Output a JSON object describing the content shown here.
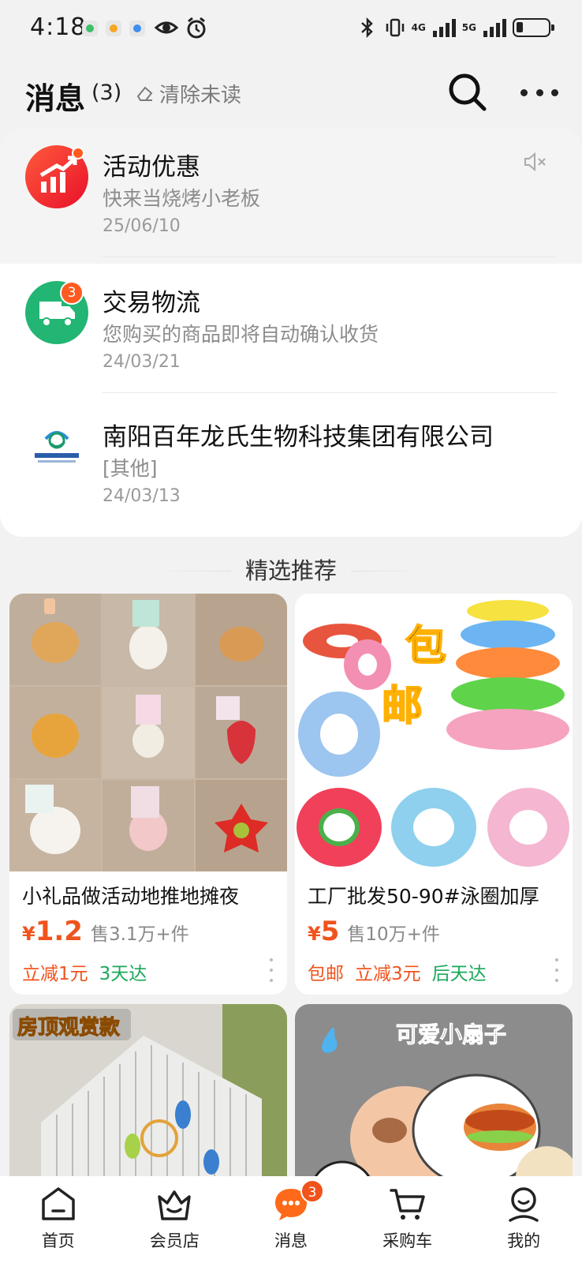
{
  "status_bar": {
    "time": "4:18",
    "network_1": "4G",
    "network_2": "5G"
  },
  "header": {
    "title": "消息",
    "count": "(3)",
    "clear_label": "清除未读"
  },
  "messages": [
    {
      "title": "活动优惠",
      "subtitle": "快来当烧烤小老板",
      "date": "25/06/10",
      "icon": "chart-up-icon",
      "color": "#f0301f"
    },
    {
      "title": "交易物流",
      "subtitle": "您购买的商品即将自动确认收货",
      "date": "24/03/21",
      "badge": "3",
      "icon": "truck-icon",
      "color": "#22b573"
    },
    {
      "title": "南阳百年龙氏生物科技集团有限公司",
      "subtitle": "[其他]",
      "date": "24/03/13",
      "logo_text": "百年龙氏集团"
    }
  ],
  "recommend": {
    "title": "精选推荐",
    "products": [
      {
        "title": "小礼品做活动地推地摊夜",
        "price_symbol": "¥",
        "price": "1.2",
        "sold": "售3.1万+件",
        "tags": [
          {
            "text": "立减1元",
            "color": "red"
          },
          {
            "text": "3天达",
            "color": "green"
          }
        ]
      },
      {
        "title": "工厂批发50-90#泳圈加厚",
        "price_symbol": "¥",
        "price": "5",
        "sold": "售10万+件",
        "image_text": [
          "包",
          "邮"
        ],
        "tags": [
          {
            "text": "包邮",
            "color": "red"
          },
          {
            "text": "立减3元",
            "color": "red"
          },
          {
            "text": "后天达",
            "color": "green"
          }
        ]
      },
      {
        "image_text": "房顶观赏款"
      },
      {
        "image_text": "可爱小扇子"
      }
    ]
  },
  "tab_bar": {
    "items": [
      {
        "label": "首页",
        "icon": "home-icon"
      },
      {
        "label": "会员店",
        "icon": "member-store-icon"
      },
      {
        "label": "消息",
        "icon": "message-icon",
        "badge": "3"
      },
      {
        "label": "采购车",
        "icon": "cart-icon"
      },
      {
        "label": "我的",
        "icon": "profile-icon"
      }
    ]
  },
  "colors": {
    "accent": "#f0531c",
    "green": "#1aa85a",
    "background": "#f2f2f2"
  }
}
